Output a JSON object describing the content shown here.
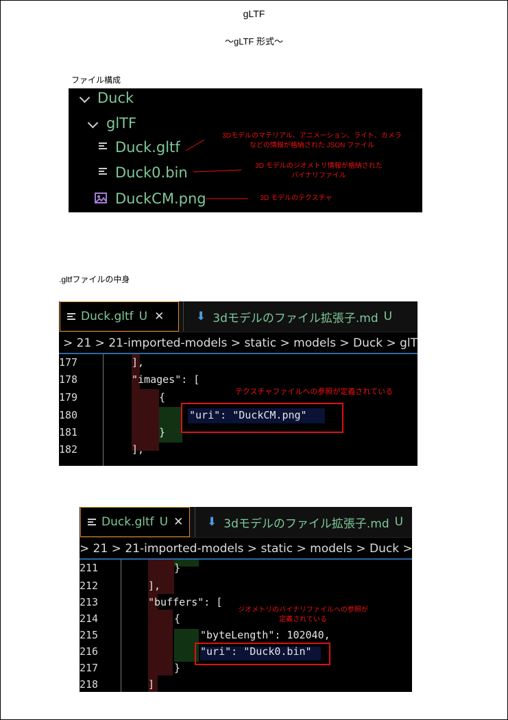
{
  "title": "gLTF",
  "subtitle": "～gLTF 形式～",
  "section1_label": "ファイル構成",
  "tree": {
    "root": "Duck",
    "folder": "glTF",
    "files": [
      "Duck.gltf",
      "Duck0.bin",
      "DuckCM.png"
    ]
  },
  "annotations": {
    "gltf_line1": "3Dモデルのマテリアル、アニメーション、ライト、カメラ",
    "gltf_line2": "などの情報が格納された JSON ファイル",
    "bin_line1": "3D モデルのジオメトリ情報が格納された",
    "bin_line2": "バイナリファイル",
    "png": "3D モデルのテクスチャ",
    "images": "テクスチャファイルへの参照が定義されている",
    "buffers_line1": "ジオメトリのバイナリファイルへの参照が",
    "buffers_line2": "定義されている"
  },
  "section2_label": ".gltfファイルの中身",
  "editor": {
    "tab_active": "Duck.gltf",
    "tab_active_badge": "U",
    "tab_other": "3dモデルのファイル拡張子.md",
    "tab_other_badge": "U",
    "breadcrumb": "> 21 > 21-imported-models > static > models > Duck > glT"
  },
  "code1": {
    "lines": [
      "177",
      "178",
      "179",
      "180",
      "181",
      "182"
    ],
    "text": [
      "],",
      "\"images\": [",
      "{",
      "\"uri\": \"DuckCM.png\"",
      "}",
      "],"
    ]
  },
  "code2": {
    "lines": [
      "211",
      "212",
      "213",
      "214",
      "215",
      "216",
      "217",
      "218"
    ],
    "text": [
      "}",
      "],",
      "\"buffers\": [",
      "{",
      "\"byteLength\": 102040,",
      "\"uri\": \"Duck0.bin\"",
      "}",
      "]"
    ]
  },
  "colors": {
    "tree_text": "#7fc99a",
    "annotation": "#ee1111",
    "tab_border": "#e08a2c"
  }
}
